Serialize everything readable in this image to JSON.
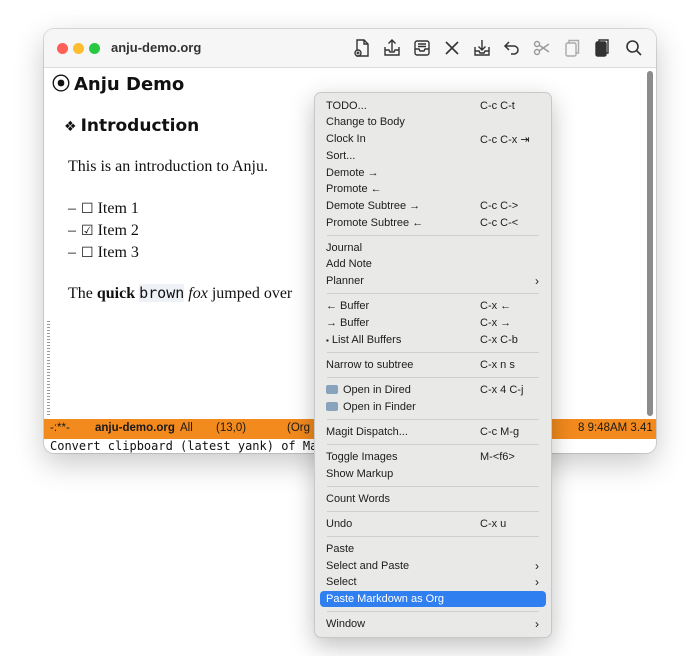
{
  "window": {
    "title": "anju-demo.org",
    "toolbar_icons": [
      "new-file-icon",
      "share-upload-icon",
      "inbox-icon",
      "close-icon",
      "download-icon",
      "undo-icon",
      "cut-icon",
      "copy-icon",
      "paste-icon",
      "search-icon"
    ]
  },
  "document": {
    "heading1": "Anju Demo",
    "heading1_bullet": "⦿",
    "heading2": "Introduction",
    "heading2_bullet": "❖",
    "intro": "This is an introduction to Anju.",
    "items": [
      {
        "dash": "–",
        "box": "☐",
        "label": "Item 1"
      },
      {
        "dash": "–",
        "box": "☑",
        "label": "Item 2"
      },
      {
        "dash": "–",
        "box": "☐",
        "label": "Item 3"
      }
    ],
    "sentence": {
      "prefix": "The ",
      "bold": "quick",
      "code": "brown",
      "italic": "fox",
      "suffix": " jumped over"
    }
  },
  "modeline": {
    "status": "-:**-",
    "buffer": "anju-demo.org",
    "position": "All",
    "coords": "(13,0)",
    "mode": "(Org l",
    "right": "8 9:48AM 3.41"
  },
  "echo_area": "Convert clipboard (latest yank) of Mark",
  "context_menu": {
    "items": [
      {
        "label": "TODO...",
        "shortcut": "C-c C-t"
      },
      {
        "label": "Change to Body",
        "shortcut": ""
      },
      {
        "label": "Clock In",
        "shortcut": "C-c C-x ⇥"
      },
      {
        "label": "Sort...",
        "shortcut": ""
      },
      {
        "label": "Demote →",
        "shortcut": ""
      },
      {
        "label": "Promote ←",
        "shortcut": ""
      },
      {
        "label": "Demote Subtree →",
        "shortcut": "C-c C->"
      },
      {
        "label": "Promote Subtree ←",
        "shortcut": "C-c C-<"
      },
      {
        "label": "Journal",
        "shortcut": ""
      },
      {
        "label": "Add Note",
        "shortcut": ""
      },
      {
        "label": "Planner",
        "shortcut": "",
        "submenu": "›"
      },
      {
        "label": "← Buffer",
        "shortcut": "C-x ←"
      },
      {
        "label": "→ Buffer",
        "shortcut": "C-x →"
      },
      {
        "label": "List All Buffers",
        "shortcut": "C-x C-b",
        "icon": "▪"
      },
      {
        "label": "Narrow to subtree",
        "shortcut": "C-x n s"
      },
      {
        "label": "Open in Dired",
        "shortcut": "C-x 4 C-j"
      },
      {
        "label": "Open in Finder",
        "shortcut": ""
      },
      {
        "label": "Magit Dispatch...",
        "shortcut": "C-c M-g"
      },
      {
        "label": "Toggle Images",
        "shortcut": "M-<f6>"
      },
      {
        "label": "Show Markup",
        "shortcut": ""
      },
      {
        "label": "Count Words",
        "shortcut": ""
      },
      {
        "label": "Undo",
        "shortcut": "C-x u"
      },
      {
        "label": "Paste",
        "shortcut": ""
      },
      {
        "label": "Select and Paste",
        "shortcut": "",
        "submenu": "›"
      },
      {
        "label": "Select",
        "shortcut": "",
        "submenu": "›"
      },
      {
        "label": "Paste Markdown as Org",
        "shortcut": "",
        "selected": true
      },
      {
        "label": "Window",
        "shortcut": "",
        "submenu": "›"
      }
    ]
  },
  "colors": {
    "modeline": "#f28a1d",
    "menu_highlight": "#2f7ff0",
    "menu_bg": "#e9e9e7"
  }
}
